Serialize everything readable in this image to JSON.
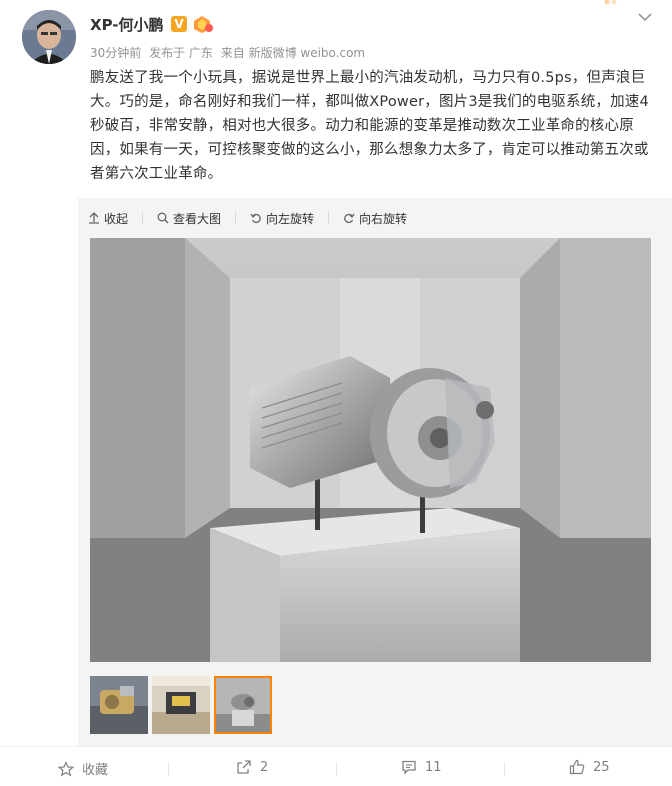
{
  "author": {
    "name": "XP-何小鹏",
    "verified_badge": "V"
  },
  "meta": {
    "time": "30分钟前",
    "location": "发布于 广东",
    "source": "来自 新版微博 weibo.com"
  },
  "post": {
    "text": "鹏友送了我一个小玩具，据说是世界上最小的汽油发动机，马力只有0.5ps，但声浪巨大。巧的是，命名刚好和我们一样，都叫做XPower，图片3是我们的电驱系统，加速4秒破百，非常安静，相对也大很多。动力和能源的变革是推动数次工业革命的核心原因，如果有一天，可控核聚变做的这么小，那么想象力太多了，肯定可以推动第五次或者第六次工业革命。"
  },
  "toolbar": {
    "collapse": "收起",
    "view_large": "查看大图",
    "rotate_left": "向左旋转",
    "rotate_right": "向右旋转"
  },
  "thumbnails": {
    "selected_index": 3,
    "count": 3
  },
  "footer": {
    "favorite": "收藏",
    "repost_count": "2",
    "comment_count": "11",
    "like_count": "25"
  },
  "colors": {
    "accent": "#ff8200",
    "verified": "#f5a623",
    "meta_text": "#939393"
  }
}
